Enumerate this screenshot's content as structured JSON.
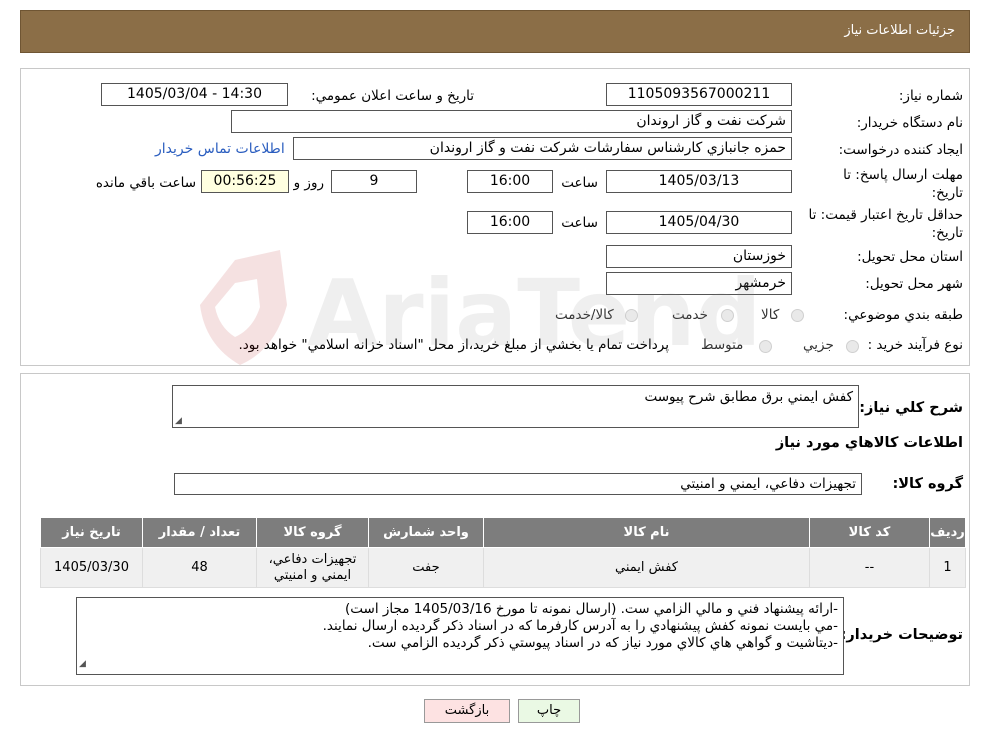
{
  "header": {
    "title": "جزئيات اطلاعات نياز"
  },
  "form": {
    "need_number_label": "شماره نياز:",
    "need_number": "1105093567000211",
    "announce_label": "تاريخ و ساعت اعلان عمومي:",
    "announce_value": "1405/03/04 - 14:30",
    "buyer_org_label": "نام دستگاه خريدار:",
    "buyer_org": "شرکت نفت و گاز اروندان",
    "creator_label": "ايجاد کننده درخواست:",
    "creator": "حمزه جانبازي کارشناس سفارشات شرکت نفت و گاز اروندان",
    "contact_link": "اطلاعات تماس خريدار",
    "deadline_label_1": "مهلت ارسال پاسخ: تا",
    "deadline_label_2": "تاريخ:",
    "deadline_date": "1405/03/13",
    "time_label": "ساعت",
    "deadline_time": "16:00",
    "days_value": "9",
    "days_label": "روز و",
    "remaining_time": "00:56:25",
    "remaining_label": "ساعت باقي مانده",
    "validity_label_1": "حداقل تاريخ اعتبار قيمت: تا",
    "validity_label_2": "تاريخ:",
    "validity_date": "1405/04/30",
    "validity_time": "16:00",
    "province_label": "استان محل تحويل:",
    "province": "خوزستان",
    "city_label": "شهر محل تحويل:",
    "city": "خرمشهر",
    "category_label": "طبقه بندي موضوعي:",
    "category_options": [
      "کالا",
      "خدمت",
      "کالا/خدمت"
    ],
    "process_label": "نوع فرآيند خريد :",
    "process_options": [
      "جزيي",
      "متوسط"
    ],
    "process_note": "پرداخت تمام يا بخشي از مبلغ خريد،از محل \"اسناد خزانه اسلامي\" خواهد بود."
  },
  "watermark": {
    "text": "AriaTender.neT"
  },
  "details": {
    "summary_label": "شرح کلي نياز:",
    "summary": "کفش ايمني برق مطابق شرح پيوست",
    "goods_info_title": "اطلاعات کالاهاي مورد نياز",
    "group_label": "گروه کالا:",
    "group": "تجهيزات دفاعي، ايمني و امنيتي",
    "table": {
      "headers": [
        "رديف",
        "کد کالا",
        "نام کالا",
        "واحد شمارش",
        "گروه کالا",
        "تعداد / مقدار",
        "تاريخ نياز"
      ],
      "rows": [
        {
          "row": "1",
          "code": "--",
          "name": "کفش ايمني",
          "unit": "جفت",
          "group": "تجهيزات دفاعي، ايمني و امنيتي",
          "qty": "48",
          "date": "1405/03/30"
        }
      ]
    },
    "buyer_notes_label": "توضيحات خريدار:",
    "buyer_notes": [
      "-ارائه پيشنهاد فني و مالي الزامي ست. (ارسال نمونه تا مورخ 1405/03/16 مجاز است)",
      "-مي بايست نمونه کفش پيشنهادي را به آدرس کارفرما که در اسناد ذکر گرديده ارسال نمايند.",
      "-ديتاشيت و گواهي هاي کالاي مورد نياز که در اسناد پيوستي ذکر گرديده الزامي ست."
    ]
  },
  "buttons": {
    "print": "چاپ",
    "back": "بازگشت"
  },
  "colors": {
    "header_bg": "#8b6e47",
    "table_header_bg": "#7d7d7d",
    "print_bg": "#eaf9e4",
    "back_bg": "#fde2e2"
  }
}
